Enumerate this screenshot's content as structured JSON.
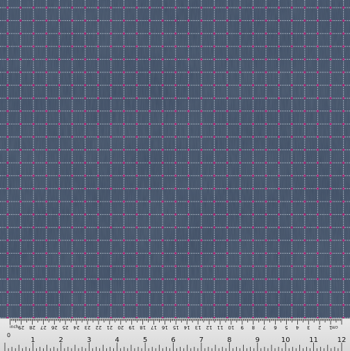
{
  "image": {
    "subject": "plaid-fabric-swatch",
    "colors": {
      "base": "#3b4a61",
      "grid_line": "#c8d0dc",
      "accent_dot": "#b02a7a",
      "ruler_bg": "#e4e4e4"
    }
  },
  "ruler": {
    "inch_label": "inch",
    "cm_label": "cm",
    "inch_numbers": [
      "1",
      "2",
      "3",
      "4",
      "5",
      "6",
      "7",
      "8",
      "9",
      "10",
      "11",
      "12"
    ],
    "cm_numbers": [
      "1",
      "2",
      "3",
      "4",
      "5",
      "6",
      "7",
      "8",
      "9",
      "10",
      "11",
      "12",
      "13",
      "14",
      "15",
      "16",
      "17",
      "18",
      "19",
      "20",
      "21",
      "22",
      "23",
      "24",
      "25",
      "26",
      "27",
      "28",
      "29",
      "30"
    ],
    "end_mark": "0"
  }
}
